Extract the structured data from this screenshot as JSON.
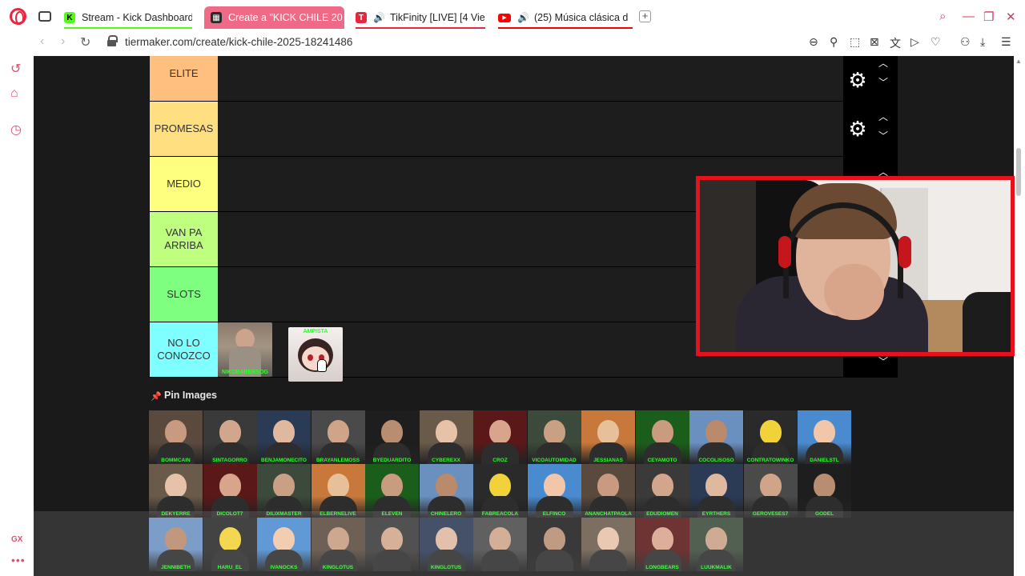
{
  "browser": {
    "tabs": [
      {
        "label": "Stream - Kick Dashboard",
        "favicon": "kick-icon",
        "color": "#53fc18"
      },
      {
        "label": "Create a \"KICK CHILE 20",
        "favicon": "tiermaker-icon",
        "color": "#ef6a86",
        "active": true
      },
      {
        "label": "TikFinity [LIVE] [4 Vie",
        "favicon": "tikfinity-icon",
        "color": "#e8263f"
      },
      {
        "label": "(25) Música clásica d",
        "favicon": "youtube-icon",
        "color": "#ff0000"
      }
    ],
    "url": "tiermaker.com/create/kick-chile-2025-18241486"
  },
  "tiers": [
    {
      "label": "ELITE",
      "color": "#ffbf7f"
    },
    {
      "label": "PROMESAS",
      "color": "#ffdf7f"
    },
    {
      "label": "MEDIO",
      "color": "#ffff7f"
    },
    {
      "label": "VAN PA ARRIBA",
      "color": "#bfff7f"
    },
    {
      "label": "SLOTS",
      "color": "#7fff7f"
    },
    {
      "label": "NO LO CONOZCO",
      "color": "#7fffff"
    }
  ],
  "tier_items": {
    "no_lo_conozco": [
      {
        "caption": "NIKOBABERSOG"
      },
      {
        "caption": "AMPISTA"
      }
    ]
  },
  "pin": {
    "title": "Pin Images"
  },
  "pool": {
    "row1": [
      "BOMMCAIN",
      "SINTAGORRO",
      "BENJAMONECITO",
      "BRAYANLEMOSS",
      "BYEDUARDITO",
      "CYBEREXX",
      "CROZ",
      "VICOAUTOMIDAD",
      "JESSIANAS",
      "CEYAMOTO",
      "COCOLISOSO",
      "CONTRATOWINKO",
      "DANIELSTL"
    ],
    "row2": [
      "DEKYERRE",
      "DICOLOT7",
      "DILIXMASTER",
      "ELBERNELIVE",
      "ELEVEN",
      "CHINELERO",
      "FABREACOLA",
      "ELFINCO",
      "ANANCHATPAOLA",
      "EDUDIOMEN",
      "EYRTHERS",
      "GEROVESES7",
      "GODEL"
    ],
    "row3": [
      "JENNIBETH",
      "HARU_EL",
      "IVANOCKS",
      "KINGLOTUS",
      "",
      "KINGLOTUS",
      "",
      "",
      "",
      "LONGBEARS",
      "LUUKMALIK"
    ]
  }
}
